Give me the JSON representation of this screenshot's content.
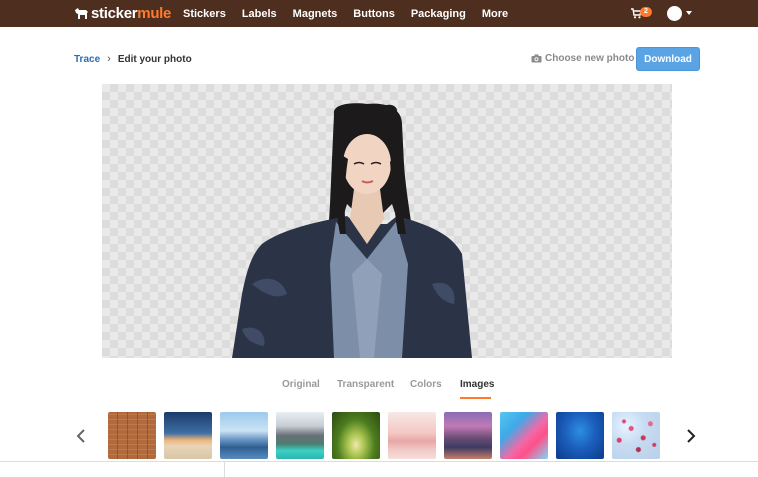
{
  "brand": {
    "name_part1": "sticker",
    "name_part2": "mule",
    "accent_color": "#ff7a2b",
    "nav_bg": "#4e2e1e"
  },
  "nav": {
    "items": [
      {
        "label": "Stickers"
      },
      {
        "label": "Labels"
      },
      {
        "label": "Magnets"
      },
      {
        "label": "Buttons"
      },
      {
        "label": "Packaging"
      },
      {
        "label": "More"
      }
    ],
    "cart_count": "2"
  },
  "breadcrumb": {
    "parent": "Trace",
    "current": "Edit your photo"
  },
  "actions": {
    "choose_new_photo": "Choose new photo",
    "download": "Download"
  },
  "tabs": [
    {
      "label": "Original",
      "active": false
    },
    {
      "label": "Transparent",
      "active": false
    },
    {
      "label": "Colors",
      "active": false
    },
    {
      "label": "Images",
      "active": true
    }
  ],
  "backgrounds": {
    "thumbnails": [
      {
        "icon": "brick-wall-thumbnail"
      },
      {
        "icon": "beach-sunset-thumbnail"
      },
      {
        "icon": "blue-mountains-thumbnail"
      },
      {
        "icon": "mountain-lake-thumbnail"
      },
      {
        "icon": "forest-path-thumbnail"
      },
      {
        "icon": "pink-hills-thumbnail"
      },
      {
        "icon": "city-canal-thumbnail"
      },
      {
        "icon": "pink-blue-paint-thumbnail"
      },
      {
        "icon": "underwater-thumbnail"
      },
      {
        "icon": "cherry-blossom-thumbnail"
      }
    ]
  },
  "icons": {
    "prev": "chevron-left-icon",
    "next": "chevron-right-icon",
    "cart": "cart-icon",
    "camera": "camera-icon"
  }
}
